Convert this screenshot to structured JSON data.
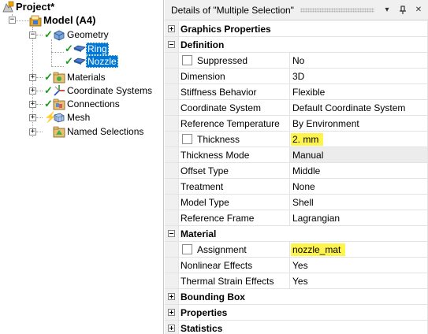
{
  "tree": {
    "project": "Project*",
    "model": "Model (A4)",
    "geometry": "Geometry",
    "ring": "Ring",
    "nozzle": "Nozzle",
    "materials": "Materials",
    "coordinate_systems": "Coordinate Systems",
    "connections": "Connections",
    "mesh": "Mesh",
    "named_selections": "Named Selections"
  },
  "details": {
    "title": "Details of \"Multiple Selection\"",
    "title_buttons": [
      "▾",
      "ᛘ",
      "✕"
    ],
    "sections": {
      "graphics": "Graphics Properties",
      "definition": "Definition",
      "material": "Material",
      "bounding_box": "Bounding Box",
      "properties": "Properties",
      "statistics": "Statistics"
    },
    "definition_rows": [
      {
        "key": "Suppressed",
        "value": "No"
      },
      {
        "key": "Dimension",
        "value": "3D"
      },
      {
        "key": "Stiffness Behavior",
        "value": "Flexible"
      },
      {
        "key": "Coordinate System",
        "value": "Default Coordinate System"
      },
      {
        "key": "Reference Temperature",
        "value": "By Environment"
      },
      {
        "key": "Thickness",
        "value": "2. mm"
      },
      {
        "key": "Thickness Mode",
        "value": "Manual"
      },
      {
        "key": "Offset Type",
        "value": "Middle"
      },
      {
        "key": "Treatment",
        "value": "None"
      },
      {
        "key": "Model Type",
        "value": "Shell"
      },
      {
        "key": "Reference Frame",
        "value": "Lagrangian"
      }
    ],
    "material_rows": [
      {
        "key": "Assignment",
        "value": "nozzle_mat"
      },
      {
        "key": "Nonlinear Effects",
        "value": "Yes"
      },
      {
        "key": "Thermal Strain Effects",
        "value": "Yes"
      }
    ]
  },
  "colors": {
    "selection": "#0078d7",
    "highlight": "#fff34d",
    "check": "#1a9b1a"
  }
}
